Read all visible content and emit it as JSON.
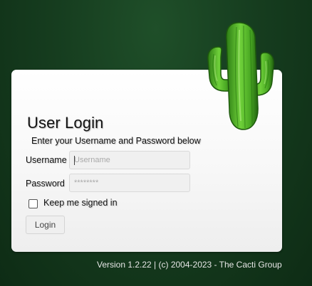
{
  "login": {
    "title": "User Login",
    "subtitle": "Enter your Username and Password below",
    "username_label": "Username",
    "username_placeholder": "Username",
    "username_value": "",
    "password_label": "Password",
    "password_placeholder": "********",
    "password_value": "",
    "remember_label": "Keep me signed in",
    "remember_checked": false,
    "login_button": "Login"
  },
  "footer": {
    "version_text": "Version 1.2.22 | (c) 2004-2023 - The Cacti Group"
  },
  "icons": {
    "logo": "cactus-logo-icon"
  },
  "colors": {
    "background": "#163d1f",
    "panel": "#f7f7f7",
    "cactus": "#5fbf2f"
  }
}
